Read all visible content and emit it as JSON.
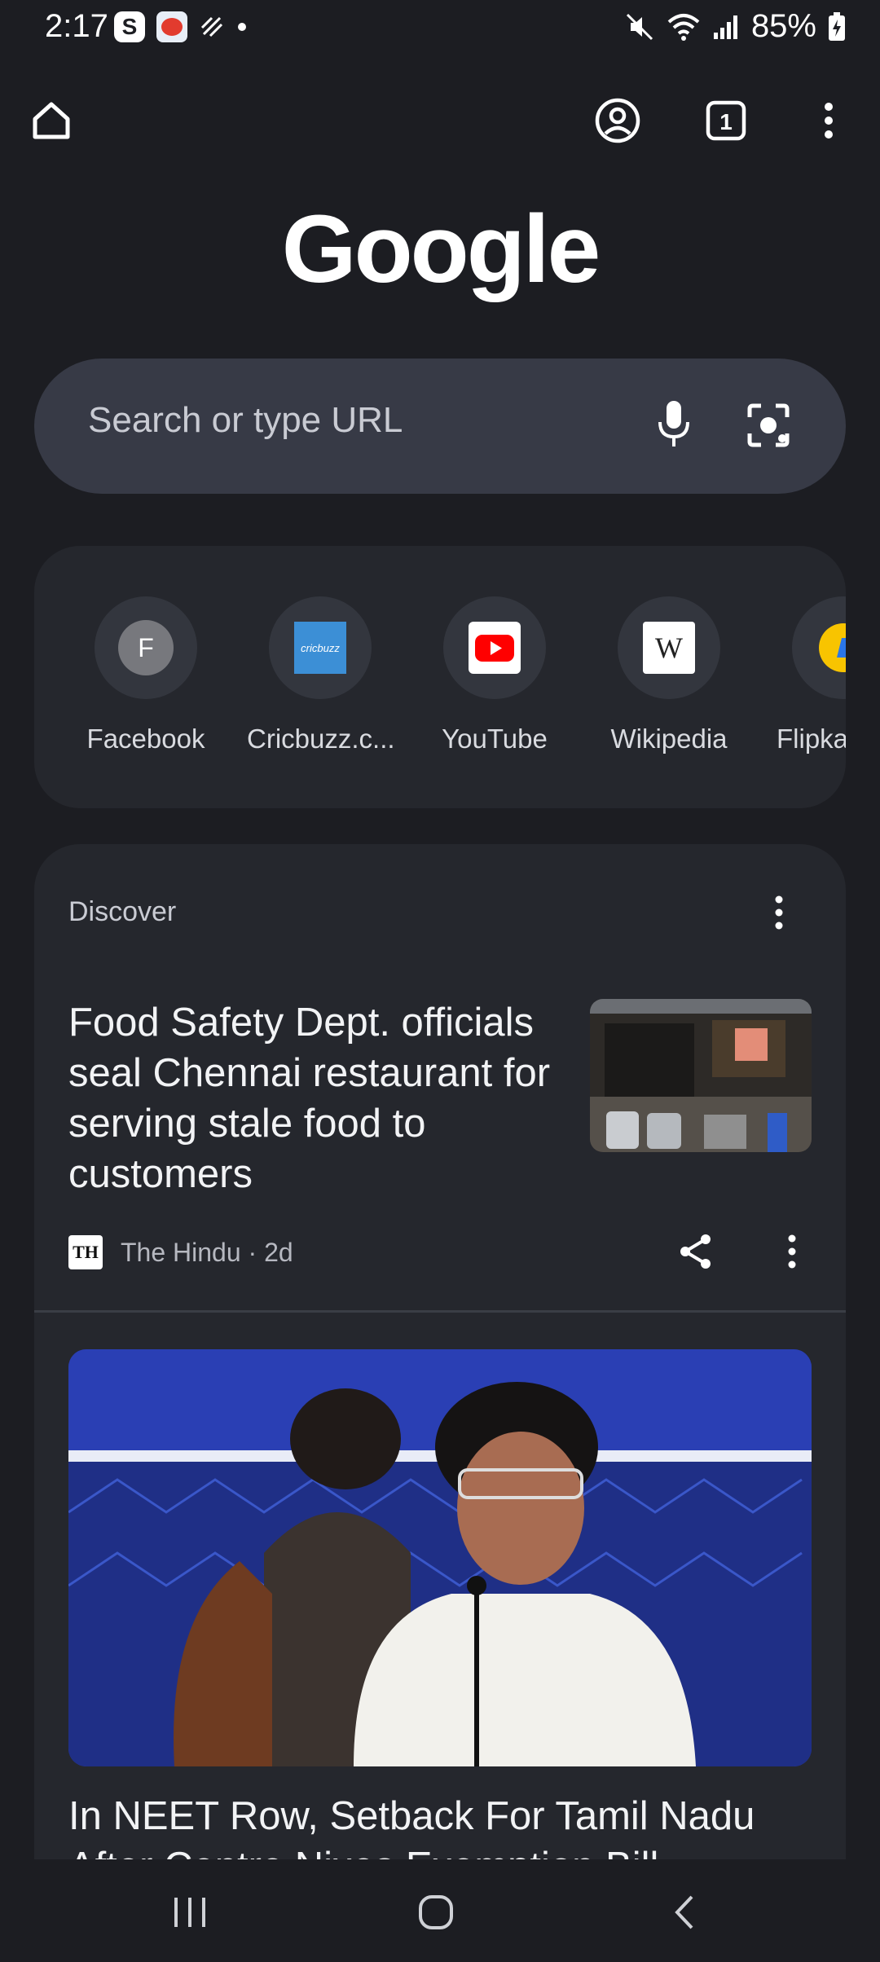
{
  "status": {
    "time": "2:17",
    "notification_s": "S",
    "battery": "85%"
  },
  "toolbar": {
    "tab_count": "1"
  },
  "logo": "Google",
  "search": {
    "placeholder": "Search or type URL"
  },
  "shortcuts": [
    {
      "label": "Facebook",
      "initial": "F"
    },
    {
      "label": "Cricbuzz.c...",
      "icon_text": "cricbuzz"
    },
    {
      "label": "YouTube"
    },
    {
      "label": "Wikipedia",
      "icon_text": "W"
    },
    {
      "label": "Flipkar"
    }
  ],
  "discover": {
    "title": "Discover",
    "articles": [
      {
        "title": "Food Safety Dept. officials seal Chennai restaurant for serving stale food to customers",
        "source": "The Hindu · 2d",
        "source_logo": "TH"
      },
      {
        "title": "In NEET Row, Setback For Tamil Nadu After Centre Nixes Exemption Bill"
      }
    ]
  }
}
